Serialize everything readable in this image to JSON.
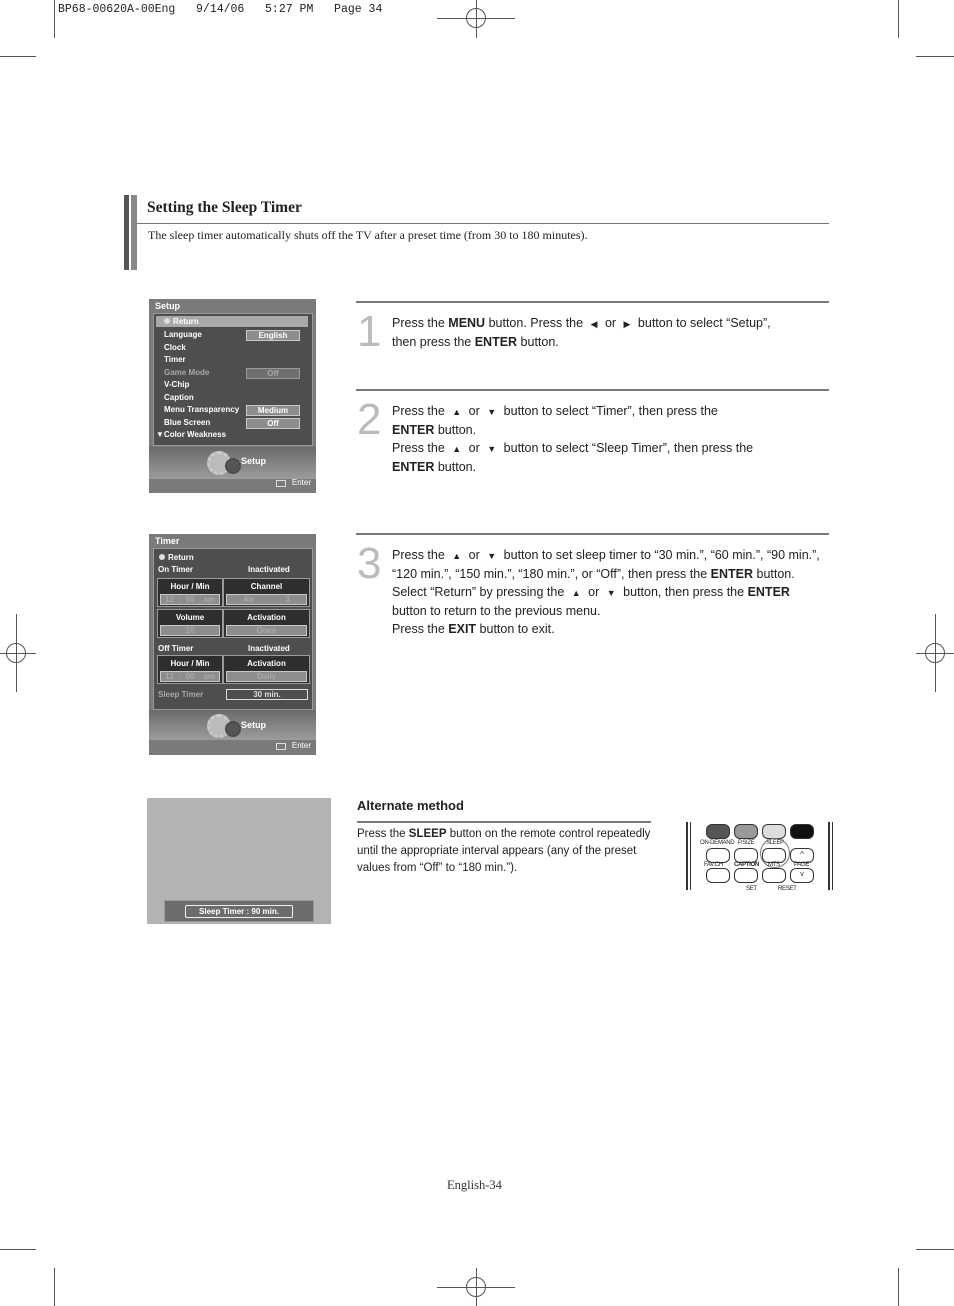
{
  "print_header": "BP68-00620A-00Eng   9/14/06   5:27 PM   Page 34",
  "section": {
    "title": "Setting the Sleep Timer",
    "intro": "The sleep timer automatically shuts off the TV after a preset time (from 30 to 180 minutes)."
  },
  "setup_menu": {
    "title": "Setup",
    "return_label": "Return",
    "items": [
      {
        "label": "Language",
        "value": "English",
        "dim": false
      },
      {
        "label": "Clock",
        "value": null,
        "dim": false
      },
      {
        "label": "Timer",
        "value": null,
        "dim": false
      },
      {
        "label": "Game Mode",
        "value": "Off",
        "dim": true
      },
      {
        "label": "V-Chip",
        "value": null,
        "dim": false
      },
      {
        "label": "Caption",
        "value": null,
        "dim": false
      },
      {
        "label": "Menu Transparency",
        "value": "Medium",
        "dim": false
      },
      {
        "label": "Blue Screen",
        "value": "Off",
        "dim": false
      },
      {
        "label": "▼Color Weakness",
        "value": null,
        "dim": false
      }
    ],
    "footer_label": "Setup",
    "enter_label": "Enter"
  },
  "timer_menu": {
    "title": "Timer",
    "return_label": "Return",
    "on_timer": {
      "label": "On Timer",
      "status": "Inactivated",
      "hour_min": {
        "header": "Hour / Min",
        "value": "12  :  00    am"
      },
      "channel": {
        "header": "Channel",
        "value": "Air              3"
      },
      "volume": {
        "header": "Volume",
        "value": "10"
      },
      "activation": {
        "header": "Activation",
        "value": "Once"
      }
    },
    "off_timer": {
      "label": "Off Timer",
      "status": "Inactivated",
      "hour_min": {
        "header": "Hour / Min",
        "value": "12  :  00    am"
      },
      "activation": {
        "header": "Activation",
        "value": "Daily"
      }
    },
    "sleep_timer": {
      "label": "Sleep Timer",
      "value": "30 min."
    },
    "footer_label": "Setup",
    "enter_label": "Enter"
  },
  "steps": [
    {
      "number": "1",
      "lines": [
        [
          "Press the ",
          {
            "b": "MENU"
          },
          " button. Press the ",
          {
            "icon": "left"
          },
          " or ",
          {
            "icon": "right"
          },
          " button to select “Setup”,"
        ],
        [
          "then press the  ",
          {
            "b": "ENTER"
          },
          " button."
        ]
      ]
    },
    {
      "number": "2",
      "lines": [
        [
          "Press the ",
          {
            "icon": "up"
          },
          " or ",
          {
            "icon": "down"
          },
          " button to select “Timer”, then press the"
        ],
        [
          {
            "b": "ENTER"
          },
          " button."
        ],
        [
          "Press the ",
          {
            "icon": "up"
          },
          " or ",
          {
            "icon": "down"
          },
          " button to select “Sleep Timer”, then press the"
        ],
        [
          {
            "b": "ENTER"
          },
          " button."
        ]
      ]
    },
    {
      "number": "3",
      "lines": [
        [
          "Press the ",
          {
            "icon": "up"
          },
          " or ",
          {
            "icon": "down"
          },
          " button to set sleep timer to “30 min.”, “60 min.”, “90 min.”,"
        ],
        [
          "“120 min.”, “150 min.”, “180 min.”, or “Off”, then press the ",
          {
            "b": "ENTER"
          },
          " button."
        ],
        [
          "Select “Return” by pressing the ",
          {
            "icon": "up"
          },
          " or ",
          {
            "icon": "down"
          },
          " button, then press the ",
          {
            "b": "ENTER"
          }
        ],
        [
          "button to return to the previous menu."
        ],
        [
          "Press the ",
          {
            "b": "EXIT"
          },
          " button to exit."
        ]
      ]
    }
  ],
  "alternate": {
    "title": "Alternate method",
    "text_pre": "Press the ",
    "text_bold": "SLEEP",
    "text_post": " button on the remote control repeatedly until the appropriate interval appears (any of the preset values from “Off” to “180 min.”).",
    "osd_label": "Sleep Timer : 90 min."
  },
  "remote": {
    "labels": [
      "ON-DEMAND",
      "P.SIZE",
      "SLEEP",
      "FAV.CH",
      "CAPTION",
      "MTS",
      "PAGE",
      "SET",
      "RESET"
    ]
  },
  "page_number": "English-34"
}
